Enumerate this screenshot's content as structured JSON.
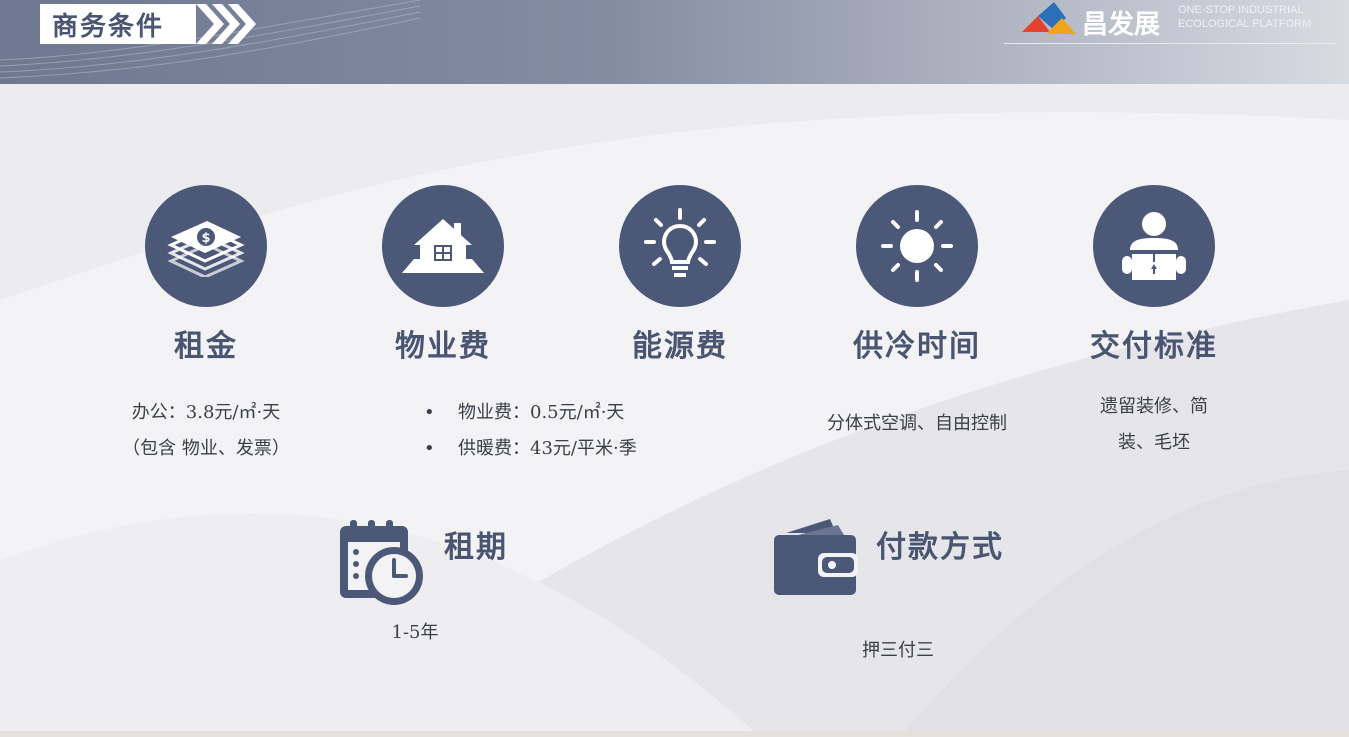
{
  "header": {
    "title": "商务条件",
    "logo_name": "昌发展",
    "logo_sub_line1": "ONE-STOP INDUSTRIAL",
    "logo_sub_line2": "ECOLOGICAL PLATFORM"
  },
  "items": [
    {
      "icon": "money-icon",
      "title": "租金",
      "lines": [
        "办公：3.8元/㎡·天",
        "（包含 物业、发票）"
      ]
    },
    {
      "icon": "house-icon",
      "title": "物业费",
      "bullets": [
        "物业费：0.5元/㎡·天",
        "供暖费：43元/平米·季"
      ]
    },
    {
      "icon": "lightbulb-icon",
      "title": "能源费"
    },
    {
      "icon": "sun-icon",
      "title": "供冷时间",
      "lines": [
        "分体式空调、自由控制"
      ]
    },
    {
      "icon": "person-box-icon",
      "title": "交付标准",
      "lines": [
        "遗留装修、简",
        "装、毛坯"
      ]
    }
  ],
  "lease": {
    "icon": "calendar-clock-icon",
    "title": "租期",
    "value": "1-5年"
  },
  "payment": {
    "icon": "wallet-icon",
    "title": "付款方式",
    "value": "押三付三"
  },
  "colors": {
    "accent": "#4c5877",
    "title_text": "#4a5572"
  }
}
